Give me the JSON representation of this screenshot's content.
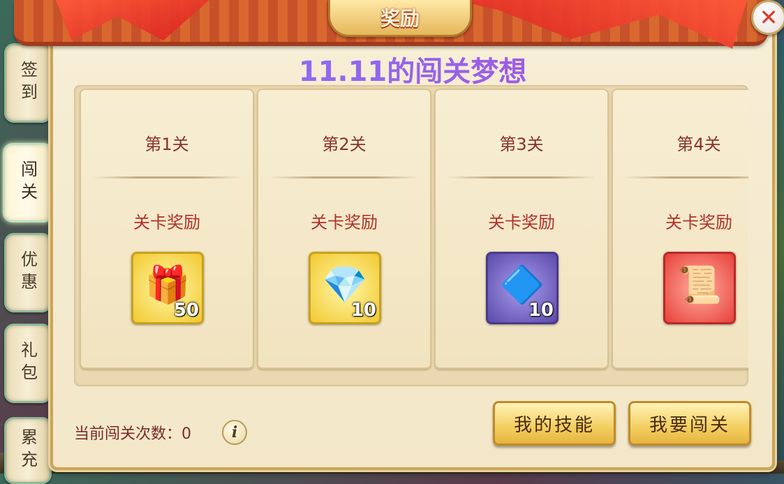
{
  "window": {
    "title": "奖励",
    "close_label": "✕"
  },
  "side_tabs": [
    {
      "label": "签到",
      "active": false
    },
    {
      "label": "闯关",
      "active": true
    },
    {
      "label": "优惠",
      "active": false
    },
    {
      "label": "礼包",
      "active": false
    },
    {
      "label": "累充",
      "active": false
    }
  ],
  "event_title": "11.11的闯关梦想",
  "stages": [
    {
      "name": "第1关",
      "reward_label": "关卡奖励",
      "item_icon": "gift-box-icon",
      "glyph": "🎁",
      "quantity": "50",
      "rarity_color": "#f2c930"
    },
    {
      "name": "第2关",
      "reward_label": "关卡奖励",
      "item_icon": "amber-gem-icon",
      "glyph": "💎",
      "quantity": "10",
      "rarity_color": "#f2c930"
    },
    {
      "name": "第3关",
      "reward_label": "关卡奖励",
      "item_icon": "blue-crystal-icon",
      "glyph": "🔷",
      "quantity": "10",
      "rarity_color": "#5b4aa8"
    },
    {
      "name": "第4关",
      "reward_label": "关卡奖励",
      "item_icon": "scroll-icon",
      "glyph": "📜",
      "quantity": "",
      "rarity_color": "#e8403a"
    }
  ],
  "footer": {
    "attempts_text": "当前闯关次数：0",
    "info_label": "i",
    "my_skills_button": "我的技能",
    "challenge_button": "我要闯关"
  }
}
